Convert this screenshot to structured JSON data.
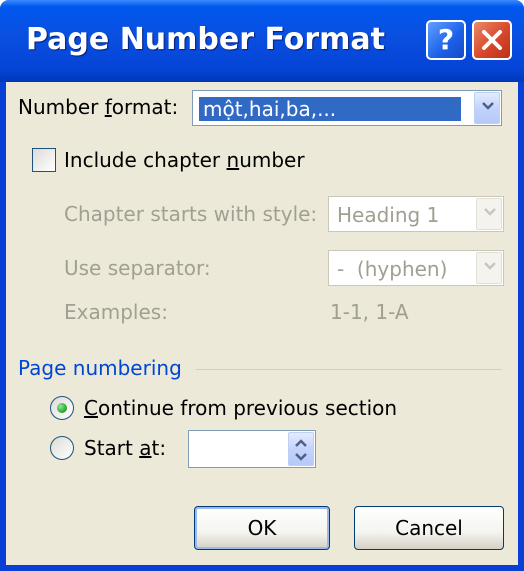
{
  "window": {
    "title": "Page Number Format",
    "help_label": "?",
    "close_icon": "close-icon",
    "titlebar_color": "#0a4fe0"
  },
  "number_format": {
    "label_pre": "Number ",
    "label_accel": "f",
    "label_post": "ormat:",
    "value": "một,hai,ba,...",
    "selection_color": "#316ac5"
  },
  "chapter": {
    "include_label_pre": "Include chapter ",
    "include_label_accel": "n",
    "include_label_post": "umber",
    "checked": false,
    "starts_with_label": "Chapter starts with style:",
    "starts_with_value": "Heading 1",
    "separator_label": "Use separator:",
    "separator_value": "-  (hyphen)",
    "examples_label": "Examples:",
    "examples_value": "1-1, 1-A"
  },
  "page_numbering": {
    "group_label": "Page numbering",
    "group_label_color": "#0046d5",
    "continue_accel": "C",
    "continue_label_rest": "ontinue from previous section",
    "start_at_pre": "Start ",
    "start_at_accel": "a",
    "start_at_post": "t:",
    "selected_option": "continue",
    "start_at_value": ""
  },
  "buttons": {
    "ok": "OK",
    "cancel": "Cancel"
  }
}
